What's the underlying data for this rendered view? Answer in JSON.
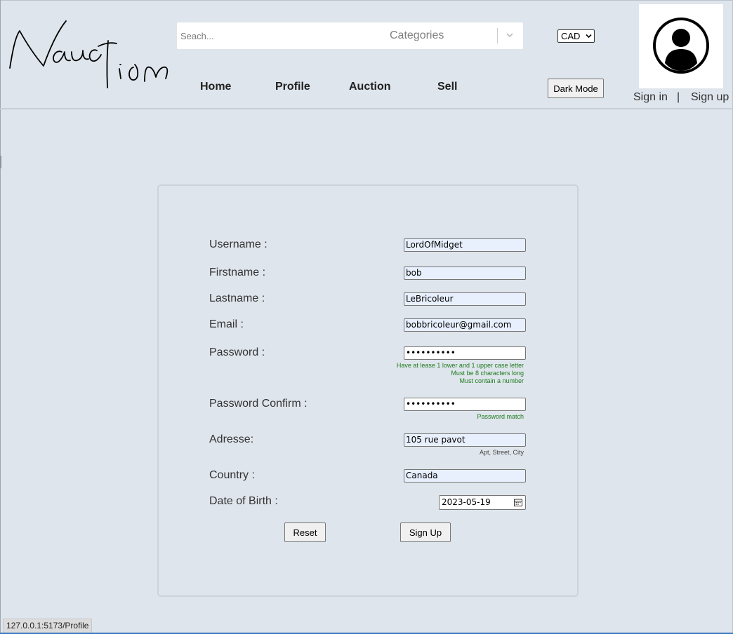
{
  "header": {
    "logo_text": "Nauction",
    "search": {
      "placeholder": "Seach..."
    },
    "categories_label": "Categories",
    "currency": "CAD",
    "nav": [
      "Home",
      "Profile",
      "Auction",
      "Sell"
    ],
    "dark_mode_label": "Dark Mode",
    "sign_in": "Sign in",
    "divider": "|",
    "sign_up": "Sign up"
  },
  "form": {
    "fields": [
      {
        "label": "Username :",
        "value": "LordOfMidget"
      },
      {
        "label": "Firstname :",
        "value": "bob"
      },
      {
        "label": "Lastname :",
        "value": "LeBricoleur"
      },
      {
        "label": "Email :",
        "value": "bobbricoleur@gmail.com"
      },
      {
        "label": "Password :",
        "value": "••••••••••"
      },
      {
        "label": "Password Confirm :",
        "value": "••••••••••"
      },
      {
        "label": "Adresse:",
        "value": "105 rue pavot"
      },
      {
        "label": "Country :",
        "value": "Canada"
      },
      {
        "label": "Date of Birth :",
        "value": "2023-05-19"
      }
    ],
    "password_hints": [
      "Have at lease 1 lower and 1 upper case letter",
      "Must be 8 characters long",
      "Must contain a number"
    ],
    "password_match": "Password match",
    "address_hint": "Apt, Street, City",
    "reset_label": "Reset",
    "signup_label": "Sign Up"
  },
  "status_bar": {
    "url": "127.0.0.1:5173/Profile"
  },
  "colors": {
    "background": "#dfe5ec",
    "hint_green": "#1e7b1e",
    "autofill_blue": "#e8f0fe"
  }
}
